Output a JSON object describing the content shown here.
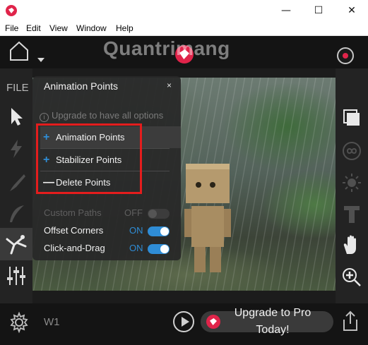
{
  "window": {
    "controls": {
      "minimize": "—",
      "maximize": "☐",
      "close": "✕"
    }
  },
  "menubar": {
    "items": [
      "File",
      "Edit",
      "View",
      "Window",
      "Help"
    ]
  },
  "watermark": "Quantrimang",
  "sidebar": {
    "file_label": "FILE"
  },
  "panel": {
    "title": "Animation Points",
    "close": "×",
    "upgrade_note": "Upgrade to have all options",
    "items": [
      {
        "symbol": "+",
        "label": "Animation Points"
      },
      {
        "symbol": "+",
        "label": "Stabilizer Points"
      },
      {
        "symbol": "—",
        "label": "Delete Points"
      }
    ],
    "options": [
      {
        "label": "Custom Paths",
        "state": "OFF",
        "enabled": false
      },
      {
        "label": "Offset Corners",
        "state": "ON",
        "enabled": true
      },
      {
        "label": "Click-and-Drag",
        "state": "ON",
        "enabled": true
      }
    ]
  },
  "footer": {
    "layer": "W1",
    "upgrade_line1": "Upgrade to Pro",
    "upgrade_line2": "Today!"
  },
  "colors": {
    "accent": "#2f8dd6",
    "brand": "#e0244a",
    "highlight_box": "#e41d1d"
  }
}
